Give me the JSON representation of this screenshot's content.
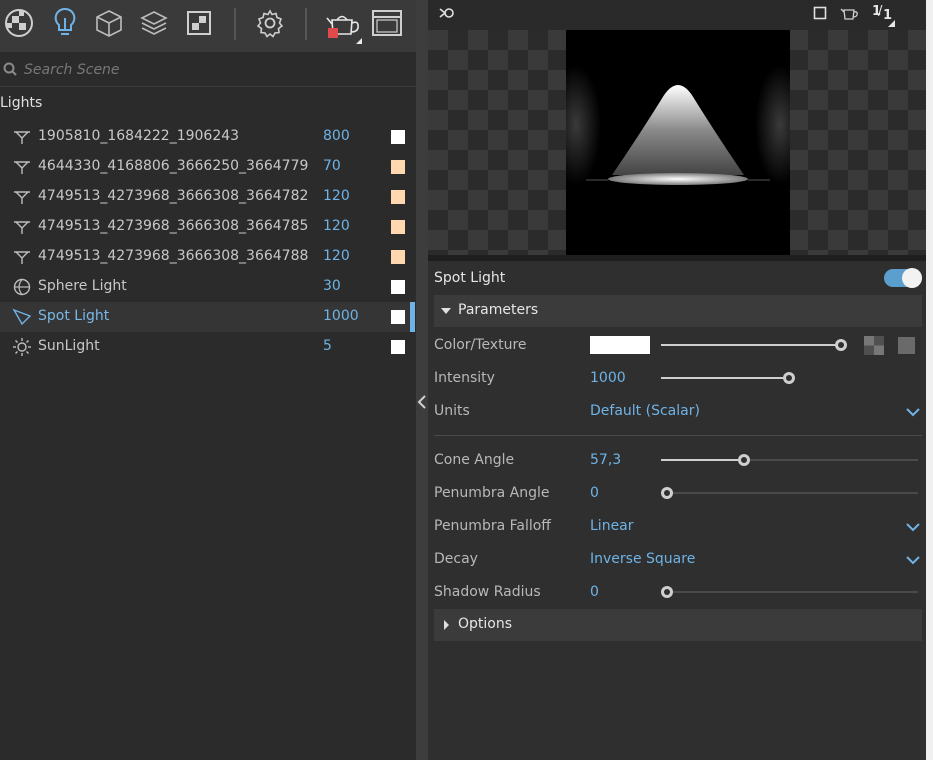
{
  "toolbar": {
    "icons": [
      "material-ball-icon",
      "lightbulb-icon",
      "cube-icon",
      "layers-icon",
      "texture-icon",
      "gear-icon",
      "teapot-render-icon",
      "render-window-icon"
    ]
  },
  "search": {
    "placeholder": "Search Scene",
    "value": ""
  },
  "scene": {
    "section": "Lights",
    "lights": [
      {
        "name": "1905810_1684222_1906243",
        "value": "800",
        "color": "#ffffff",
        "icon": "area-light-icon"
      },
      {
        "name": "4644330_4168806_3666250_3664779",
        "value": "70",
        "color": "#ffd8b0",
        "icon": "area-light-icon"
      },
      {
        "name": "4749513_4273968_3666308_3664782",
        "value": "120",
        "color": "#ffd8b0",
        "icon": "area-light-icon"
      },
      {
        "name": "4749513_4273968_3666308_3664785",
        "value": "120",
        "color": "#ffd8b0",
        "icon": "area-light-icon"
      },
      {
        "name": "4749513_4273968_3666308_3664788",
        "value": "120",
        "color": "#ffd8b0",
        "icon": "area-light-icon"
      },
      {
        "name": "Sphere Light",
        "value": "30",
        "color": "#ffffff",
        "icon": "sphere-light-icon"
      },
      {
        "name": "Spot Light",
        "value": "1000",
        "color": "#ffffff",
        "icon": "spot-light-icon",
        "selected": true
      },
      {
        "name": "SunLight",
        "value": "5",
        "color": "#ffffff",
        "icon": "sun-light-icon"
      }
    ]
  },
  "preview": {
    "resolution_top": "1",
    "resolution_bottom": "1"
  },
  "panel": {
    "title": "Spot Light",
    "enabled": true,
    "parameters_label": "Parameters",
    "options_label": "Options",
    "color_label": "Color/Texture",
    "color_value": "#ffffff",
    "intensity_label": "Intensity",
    "intensity_value": "1000",
    "units_label": "Units",
    "units_value": "Default (Scalar)",
    "cone_angle_label": "Cone Angle",
    "cone_angle_value": "57,3",
    "penumbra_angle_label": "Penumbra Angle",
    "penumbra_angle_value": "0",
    "penumbra_falloff_label": "Penumbra Falloff",
    "penumbra_falloff_value": "Linear",
    "decay_label": "Decay",
    "decay_value": "Inverse Square",
    "shadow_radius_label": "Shadow Radius",
    "shadow_radius_value": "0",
    "slider_levels": {
      "color": 1.0,
      "intensity": 0.5,
      "cone_angle": 0.32,
      "penumbra_angle": 0.0,
      "shadow_radius": 0.0
    }
  },
  "colors": {
    "accent": "#6fb3e6",
    "toggle_on": "#5b9fce"
  }
}
